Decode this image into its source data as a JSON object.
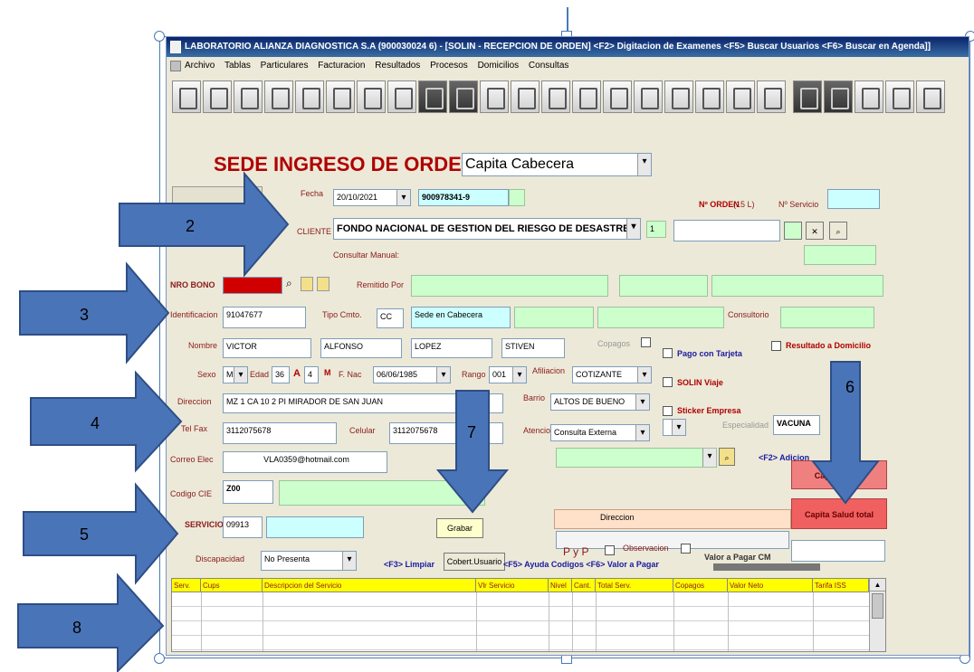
{
  "window": {
    "title": "LABORATORIO ALIANZA DIAGNOSTICA S.A (900030024 6) - [SOLIN - RECEPCION DE ORDEN] <F2> Digitacion de Examenes <F5> Buscar Usuarios <F6> Buscar en Agenda]]"
  },
  "menu": [
    "Archivo",
    "Tablas",
    "Particulares",
    "Facturacion",
    "Resultados",
    "Procesos",
    "Domicilios",
    "Consultas"
  ],
  "form": {
    "sede_label": "SEDE INGRESO DE ORDEN:",
    "sede_value": "Capita Cabecera",
    "fecha_label": "Fecha",
    "fecha_value": "20/10/2021",
    "nit_value": "900978341-9",
    "orden_label": "Nº ORDEN",
    "orden_extra": "(15 L)",
    "servicio_no_label": "Nº Servicio",
    "cliente_label": "CLIENTE",
    "cliente_value": "FONDO NACIONAL DE GESTION DEL RIESGO DE DESASTRES",
    "cliente_code": "1",
    "consultar_manual": "Consultar Manual:",
    "nro_bono_label": "NRO BONO",
    "remitido_label": "Remitido Por",
    "identificacion_label": "Identificacion",
    "identificacion_value": "91047677",
    "tipo_ccto_label": "Tipo Cmto.",
    "tipo_ccto_value": "CC",
    "sede_usuario_value": "Sede en Cabecera",
    "consultorio_label": "Consultorio",
    "nombre_label": "Nombre",
    "nombre1": "VICTOR",
    "nombre2": "ALFONSO",
    "apellido1": "LOPEZ",
    "apellido2": "STIVEN",
    "copagos_label": "Copagos",
    "pago_tarjeta": "Pago con Tarjeta",
    "resultado_domicilio": "Resultado a Domicilio",
    "sexo_label": "Sexo",
    "sexo_value": "M",
    "edad_label": "Edad",
    "edad_value": "36",
    "edad_unit": "A",
    "meses_value": "4",
    "meses_unit": "M",
    "fnac_label": "F. Nac",
    "fnac_value": "06/06/1985",
    "rango_label": "Rango",
    "rango_value": "001",
    "afiliacion_label": "Afiliacion",
    "afiliacion_value": "COTIZANTE",
    "solin_viaje": "SOLIN Viaje",
    "direccion_label": "Direccion",
    "direccion_value": "MZ 1 CA 10 2 PI MIRADOR DE SAN JUAN",
    "barrio_label": "Barrio",
    "barrio_value": "ALTOS DE BUENO",
    "sticker": "Sticker Empresa",
    "especialidad_label": "Especialidad",
    "especialidad_value": "VACUNA",
    "telfax_label": "Tel Fax",
    "telfax_value": "3112075678",
    "celular_label": "Celular",
    "celular_value": "3112075678",
    "atencion_label": "Atencion",
    "atencion_value": "Consulta Externa",
    "correo_label": "Correo Elec",
    "correo_value": "VLA0359@hotmail.com",
    "f2_label": "<F2> Adicion",
    "codigo_cie_label": "Codigo CIE",
    "codigo_cie_value": "Z00",
    "capita_button": "Capita Salud",
    "capita_total_button": "Capita Salud total",
    "servicio_label": "SERVICIO",
    "servicio_value": "09913",
    "grabar_button": "Grabar",
    "direccion_tag": "Direccion",
    "pyp_label": "P y P",
    "observacion_label": "Observacion",
    "valor_pagar_label": "Valor a Pagar CM",
    "discapacidad_label": "Discapacidad",
    "discapacidad_value": "No Presenta",
    "footer_hints": "<F3> Limpiar",
    "cobertura_button": "Cobert.Usuario",
    "footer_hints2": "<F5> Ayuda Codigos <F6> Valor a Pagar"
  },
  "grid": {
    "columns": [
      "Serv.",
      "Cups",
      "Descripcion del Servicio",
      "Vlr Servicio",
      "Nivel",
      "Cant.",
      "Total Serv.",
      "Copagos",
      "Valor Neto",
      "Tarifa ISS"
    ]
  },
  "annotations": [
    "2",
    "3",
    "4",
    "5",
    "6",
    "7",
    "8"
  ],
  "colors": {
    "arrow": "#4a74b8",
    "arrow_border": "#2e4e85",
    "title_bar": "#0a246a"
  }
}
